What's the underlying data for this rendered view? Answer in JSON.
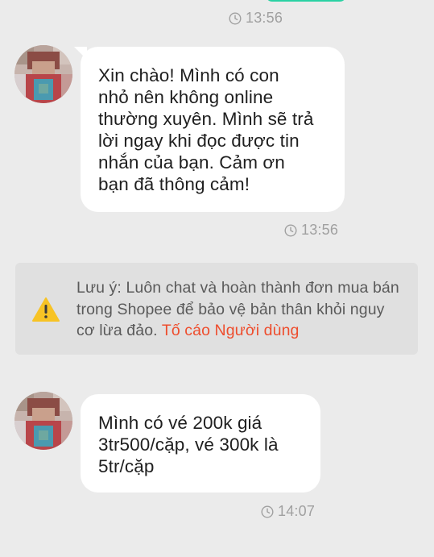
{
  "theme": {
    "background": "#ebebeb",
    "bubble": "#ffffff",
    "accent_link": "#ee4d2d",
    "warning_yellow": "#f7c325",
    "top_bubble_green": "#2ad1a3"
  },
  "messages": {
    "top_time": "13:56",
    "first": {
      "text": "Xin chào! Mình có con\nnhỏ nên không online\nthường xuyên. Mình sẽ trả\nlời ngay khi đọc được tin\nnhắn của bạn. Cảm ơn\nbạn đã thông cảm!",
      "time": "13:56"
    },
    "second": {
      "text": "Mình có vé 200k giá\n3tr500/cặp, vé 300k là\n5tr/cặp",
      "time": "14:07"
    }
  },
  "notice": {
    "icon": "warning-icon",
    "text": "Lưu ý: Luôn chat và hoàn thành đơn mua bán trong Shopee để bảo vệ bản thân khỏi nguy cơ lừa đảo. ",
    "link_label": "Tố cáo Người dùng"
  },
  "icons": {
    "clock": "clock-icon",
    "avatar": "avatar"
  }
}
